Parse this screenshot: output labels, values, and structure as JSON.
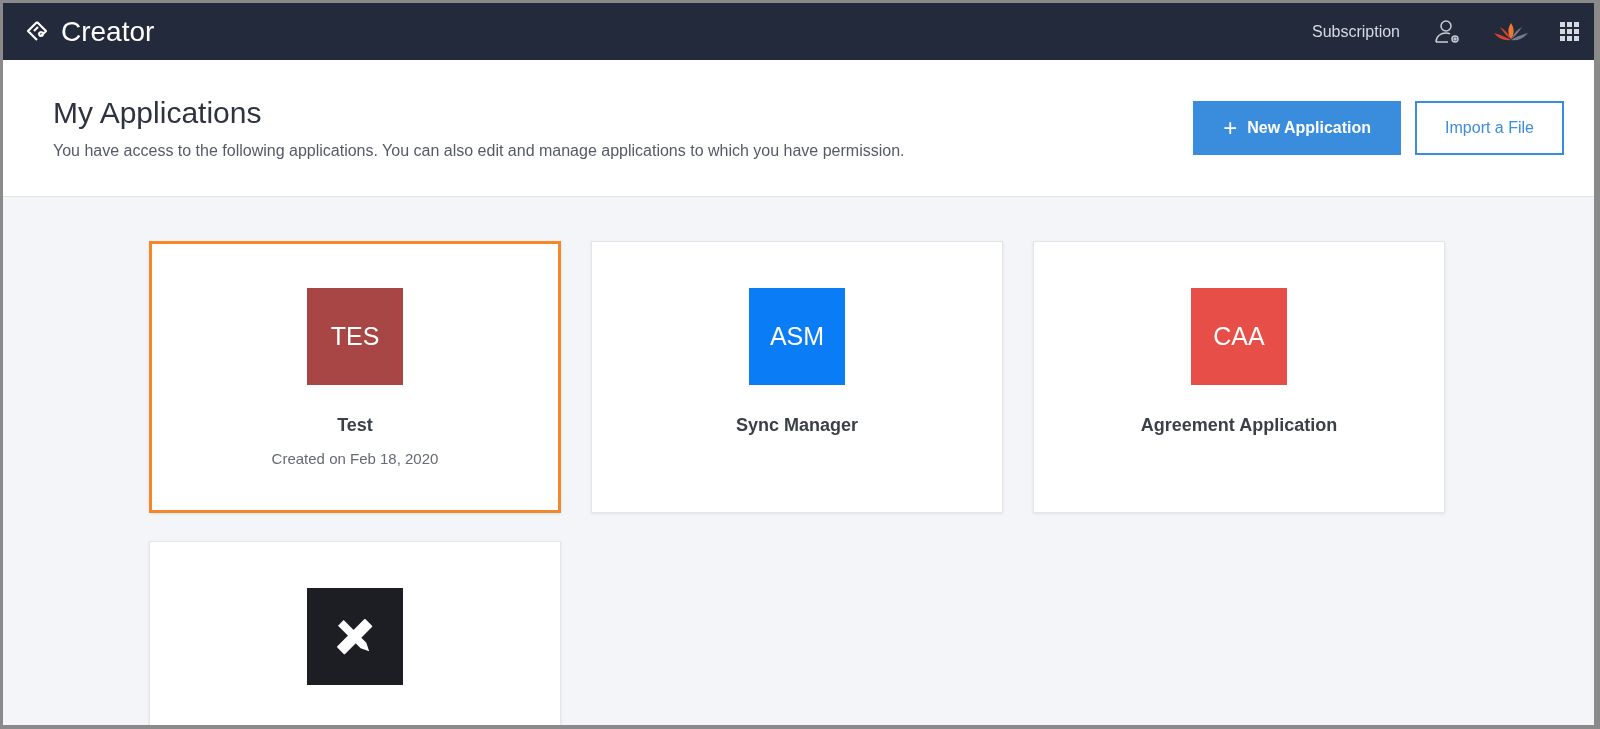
{
  "header": {
    "brand": "Creator",
    "links": [
      "Subscription"
    ]
  },
  "page": {
    "title": "My Applications",
    "subtitle": "You have access to the following applications. You can also edit and manage applications to which you have permission."
  },
  "actions": [
    {
      "kind": "primary",
      "icon": "+",
      "label": "New Application"
    },
    {
      "kind": "outline",
      "label": "Import a File"
    }
  ],
  "applications": [
    {
      "kind": "app",
      "abbr": "TES",
      "color": "#a84646",
      "name": "Test",
      "created": "Created on Feb 18, 2020",
      "selected": true
    },
    {
      "kind": "app",
      "abbr": "ASM",
      "color": "#0a7cf5",
      "name": "Sync Manager",
      "selected": false
    },
    {
      "kind": "app",
      "abbr": "CAA",
      "color": "#e84e48",
      "name": "Agreement Application",
      "selected": false
    },
    {
      "kind": "create",
      "color": "#1c1e24",
      "selected": false
    }
  ]
}
